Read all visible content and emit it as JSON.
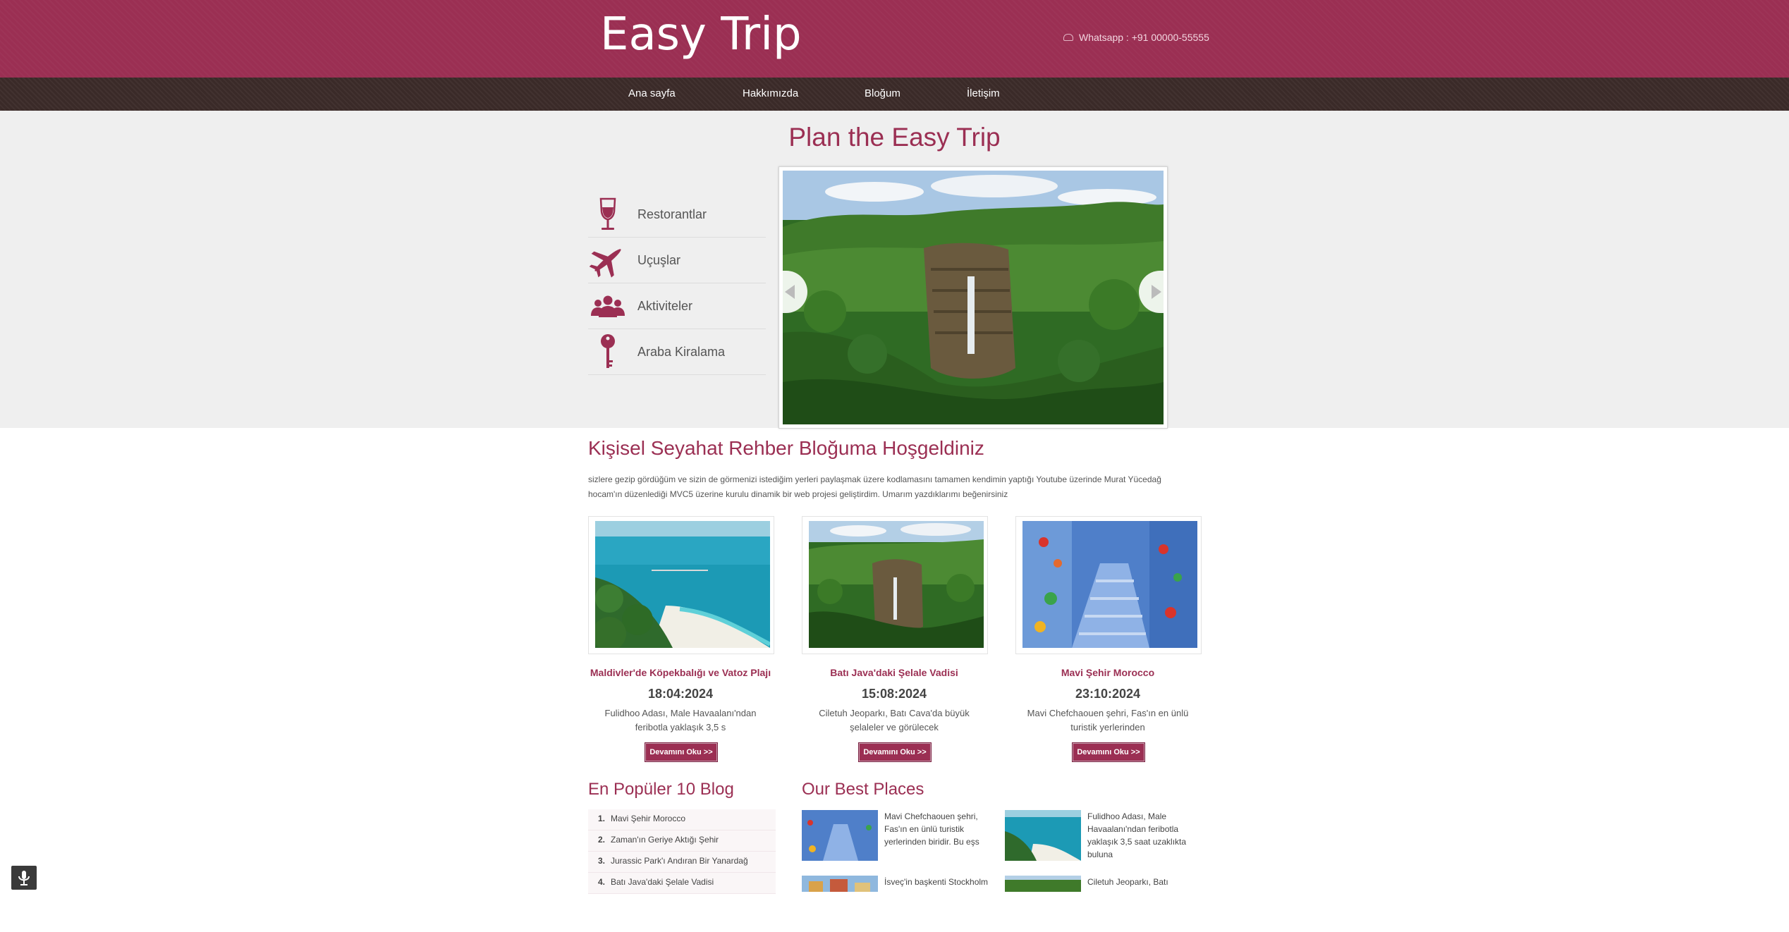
{
  "header": {
    "logo": "Easy Trip",
    "whatsapp": "Whatsapp : +91 00000-55555"
  },
  "nav": {
    "items": [
      "Ana sayfa",
      "Hakkımızda",
      "Bloğum",
      "İletişim"
    ]
  },
  "hero": {
    "title": "Plan the Easy Trip",
    "side_items": [
      {
        "label": "Restorantlar",
        "icon": "wine-glass-icon"
      },
      {
        "label": "Uçuşlar",
        "icon": "airplane-icon"
      },
      {
        "label": "Aktiviteler",
        "icon": "people-icon"
      },
      {
        "label": "Araba Kiralama",
        "icon": "key-icon"
      }
    ]
  },
  "welcome": {
    "title": "Kişisel Seyahat Rehber Bloğuma Hoşgeldiniz",
    "text": "sizlere gezip gördüğüm ve sizin de görmenizi istediğim yerleri paylaşmak üzere kodlamasını tamamen kendimin yaptığı Youtube üzerinde Murat Yücedağ hocam'ın düzenlediği MVC5 üzerine kurulu dinamik bir web projesi geliştirdim. Umarım yazdıklarımı beğenirsiniz"
  },
  "cards": [
    {
      "title": "Maldivler'de Köpekbalığı ve Vatoz Plajı",
      "date": "18:04:2024",
      "desc": "Fulidhoo Adası, Male Havaalanı'ndan feribotla yaklaşık 3,5 s",
      "button": "Devamını Oku >>"
    },
    {
      "title": "Batı Java'daki Şelale Vadisi",
      "date": "15:08:2024",
      "desc": "Ciletuh Jeoparkı, Batı Cava'da büyük şelaleler ve görülecek",
      "button": "Devamını Oku >>"
    },
    {
      "title": "Mavi Şehir Morocco",
      "date": "23:10:2024",
      "desc": "Mavi Chefchaouen şehri, Fas'ın en ünlü turistik yerlerinden",
      "button": "Devamını Oku >>"
    }
  ],
  "popular": {
    "title": "En Popüler 10 Blog",
    "items": [
      "Mavi Şehir Morocco",
      "Zaman'ın Geriye Aktığı Şehir",
      "Jurassic Park'ı Andıran Bir Yanardağ",
      "Batı Java'daki Şelale Vadisi"
    ]
  },
  "best": {
    "title": "Our Best Places",
    "items": [
      {
        "text": "Mavi Chefchaouen şehri, Fas'ın en ünlü turistik yerlerinden biridir. Bu eşs"
      },
      {
        "text": "Fulidhoo Adası, Male Havaalanı'ndan feribotla yaklaşık 3,5 saat uzaklıkta buluna"
      },
      {
        "text": "İsveç'in başkenti Stockholm"
      },
      {
        "text": "Ciletuh Jeoparkı, Batı"
      }
    ]
  },
  "colors": {
    "brand": "#9b2f53",
    "nav": "#3a2a28",
    "hero_bg": "#efefef"
  }
}
